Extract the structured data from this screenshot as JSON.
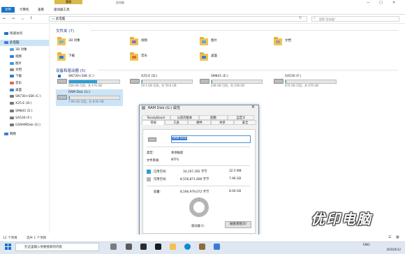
{
  "window": {
    "ribbon_tabs": [
      "文件",
      "计算机",
      "查看",
      "驱动器工具"
    ],
    "manage_tab": "管理",
    "title": "此电脑",
    "address": "此电脑",
    "search_placeholder": "搜索\"此电脑\""
  },
  "sidebar": {
    "items": [
      "快速访问",
      "此电脑",
      "3D 对象",
      "视频",
      "图片",
      "文档",
      "下载",
      "音乐",
      "桌面",
      "SN730+SSK (C:)",
      "X25-E (D:)",
      "SM841 (E:)",
      "SA530 (F:)",
      "GSRAMDisk (G:)",
      "网络"
    ]
  },
  "folders": {
    "section_title": "文件夹 (7)",
    "items": [
      "3D 对象",
      "视频",
      "图片",
      "文档",
      "下载",
      "音乐",
      "桌面"
    ]
  },
  "drives": {
    "section_title": "设备和驱动器 (5)",
    "items": [
      {
        "name": "SN730+SSK (C:)",
        "free": "208 GB 可用，共 476 GB",
        "used_fraction": 0.56
      },
      {
        "name": "X25-E (D:)",
        "free": "59.5 GB 可用，共 59.6 GB",
        "used_fraction": 0.01
      },
      {
        "name": "SM841 (E:)",
        "free": "238 GB 可用，共 238 GB",
        "used_fraction": 0.01
      },
      {
        "name": "SA530 (F:)",
        "free": "476 GB 可用，共 476 GB",
        "used_fraction": 0.01
      },
      {
        "name": "RAM Disk (G:)",
        "free": "7.96 GB 可用，共 8.00 GB",
        "used_fraction": 0.005
      }
    ]
  },
  "dialog": {
    "title": "RAM Disk (G:) 属性",
    "tabs_row1": [
      "ReadyBoost",
      "以前的版本",
      "配额",
      "自定义"
    ],
    "tabs_row2": [
      "常规",
      "工具",
      "硬件",
      "共享",
      "安全"
    ],
    "volume_name": "RAM Disk",
    "type_label": "类型:",
    "type_value": "本地磁盘",
    "fs_label": "文件系统:",
    "fs_value": "NTFS",
    "used_label": "已用空间:",
    "used_bytes": "34,107,392 字节",
    "used_size": "32.5 MB",
    "free_label": "可用空间:",
    "free_bytes": "8,556,871,680 字节",
    "free_size": "7.96 GB",
    "capacity_label": "容量:",
    "capacity_bytes": "8,590,979,072 字节",
    "capacity_size": "8.00 GB",
    "drive_label": "驱动器 G:",
    "cleanup_button": "磁盘清理(D)",
    "used_color": "#26a0da",
    "free_color": "#b5b5b5"
  },
  "status": {
    "items_count": "12 个项目",
    "selected": "选中 1 个项目"
  },
  "taskbar": {
    "search_placeholder": "在这里输入你要搜索的内容",
    "ime": "ENG",
    "date": "2020/4/12"
  },
  "watermark": "优印电脑"
}
